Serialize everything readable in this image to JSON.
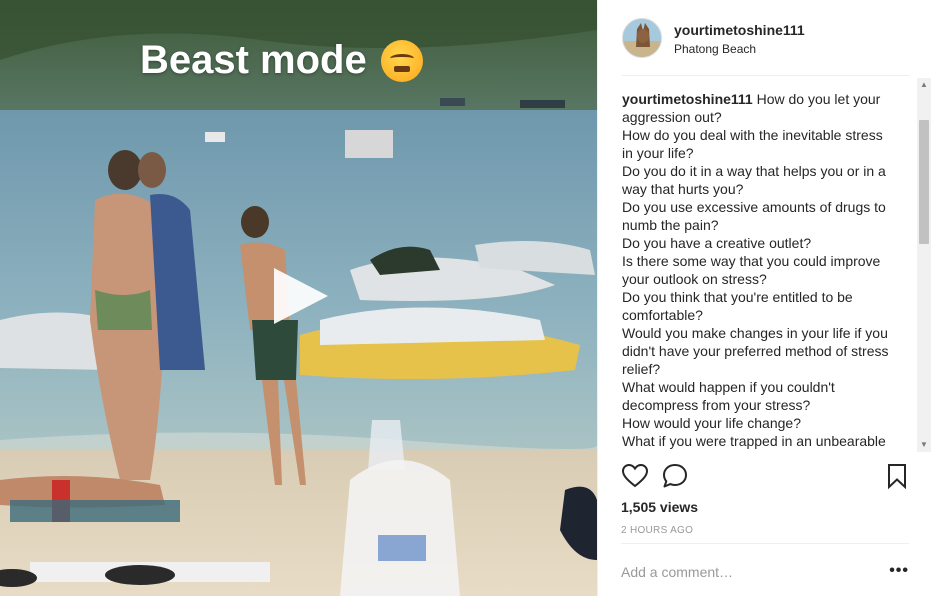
{
  "post": {
    "overlay_text": "Beast mode",
    "overlay_emoji_icon": "steam-from-nose-emoji-icon"
  },
  "header": {
    "username": "yourtimetoshine111",
    "location": "Phatong Beach"
  },
  "caption": {
    "author": "yourtimetoshine111",
    "lines": [
      "How do you let your",
      "aggression out?",
      "How do you deal with the inevitable stress",
      "in your life?",
      "Do you do it in a way that helps you or in a",
      "way that hurts you?",
      "Do you use excessive amounts of drugs to",
      "numb the pain?",
      "Do you have a creative outlet?",
      "Is there some way that you could improve",
      "your outlook on stress?",
      "Do you think that you're entitled to be",
      "comfortable?",
      "Would you make changes in your life if you",
      "didn't have your preferred method of stress",
      "relief?",
      "What would happen if you couldn't",
      "decompress from your stress?",
      "How would your life change?",
      "What if you were trapped in an unbearable"
    ]
  },
  "stats": {
    "views": "1,505 views",
    "timestamp": "2 HOURS AGO"
  },
  "comment_box": {
    "placeholder": "Add a comment…",
    "more_label": "•••"
  },
  "icons": {
    "like": "heart-icon",
    "comment": "comment-bubble-icon",
    "save": "bookmark-icon",
    "play": "play-icon"
  }
}
